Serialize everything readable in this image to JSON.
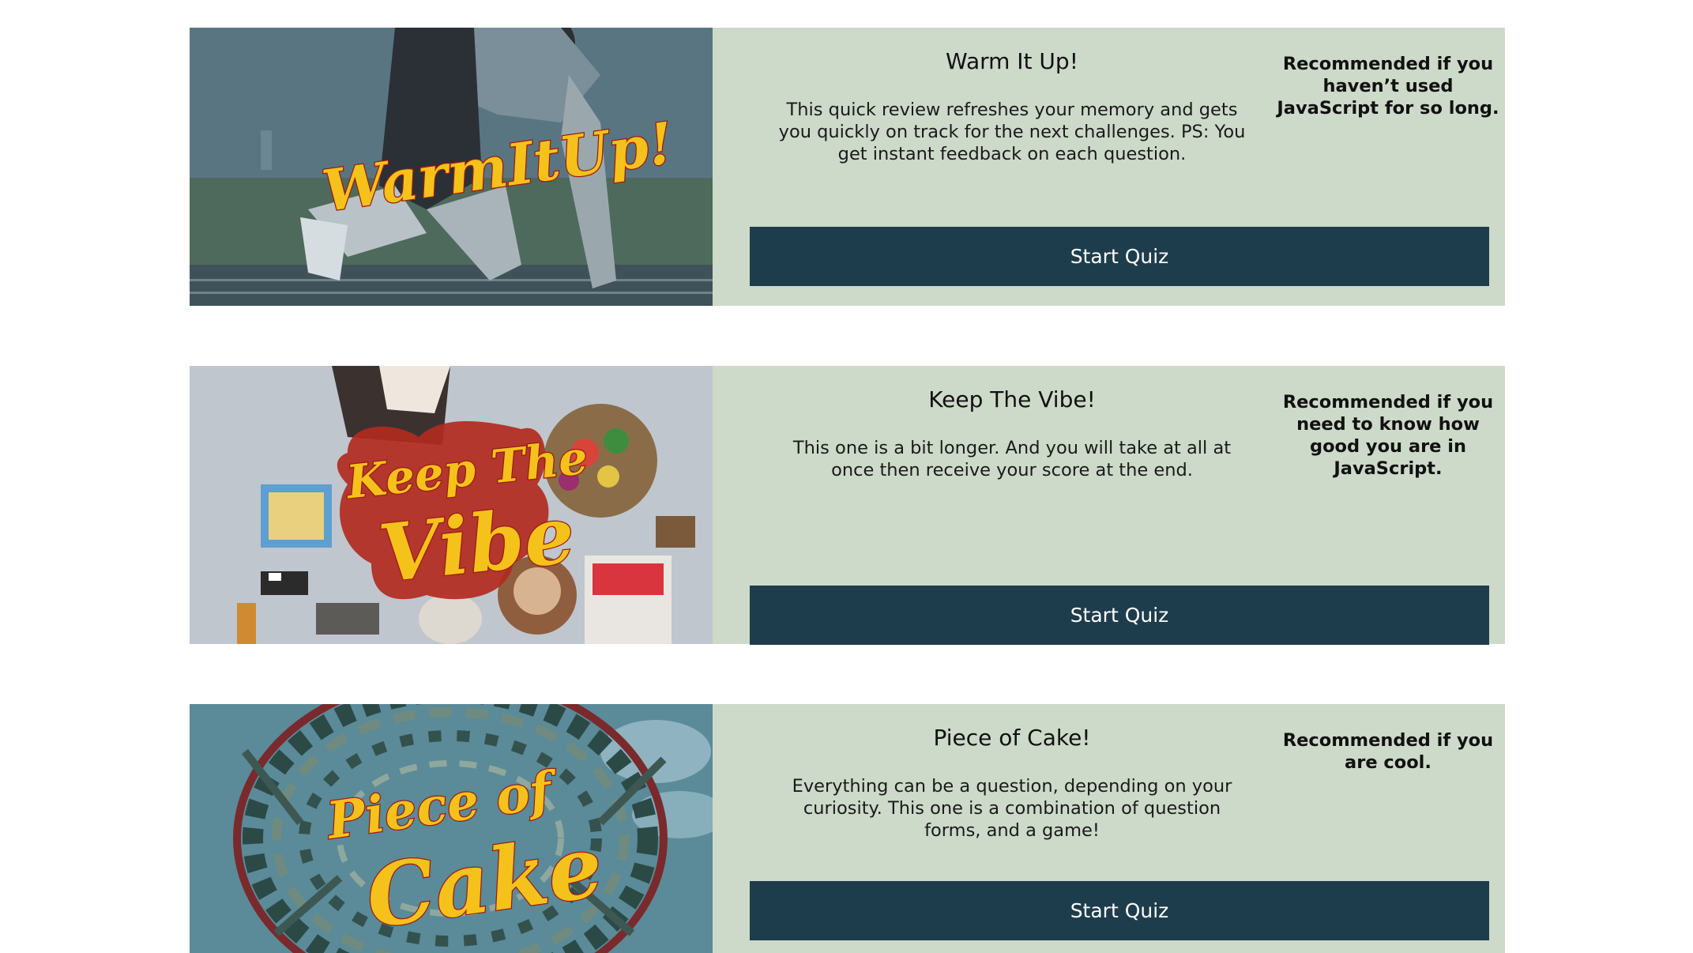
{
  "cards": [
    {
      "image_text": "WarmItUp!",
      "title": "Warm It Up!",
      "description": "This quick review refreshes your memory and gets you quickly on track for the next challenges. PS: You get instant feedback on each question.",
      "recommendation": "Recommended if you haven’t used JavaScript for so long.",
      "button_label": "Start Quiz"
    },
    {
      "image_text_line1": "Keep The",
      "image_text_line2": "Vibe",
      "title": "Keep The Vibe!",
      "description": "This one is a bit longer. And you will take at all at once then receive your score at the end.",
      "recommendation": "Recommended if you need to know how good you are in JavaScript.",
      "button_label": "Start Quiz"
    },
    {
      "image_text_line1": "Piece of",
      "image_text_line2": "Cake",
      "title": "Piece of Cake!",
      "description": "Everything can be a question, depending on your curiosity. This one is a combination of question forms, and a game!",
      "recommendation": "Recommended if you are cool.",
      "button_label": "Start Quiz"
    }
  ],
  "colors": {
    "card_background": "#cdd9c9",
    "button_background": "#1d3d4c",
    "button_text": "#ffffff",
    "logo_fill": "#f5c11b",
    "logo_outline": "#9b1b12"
  }
}
